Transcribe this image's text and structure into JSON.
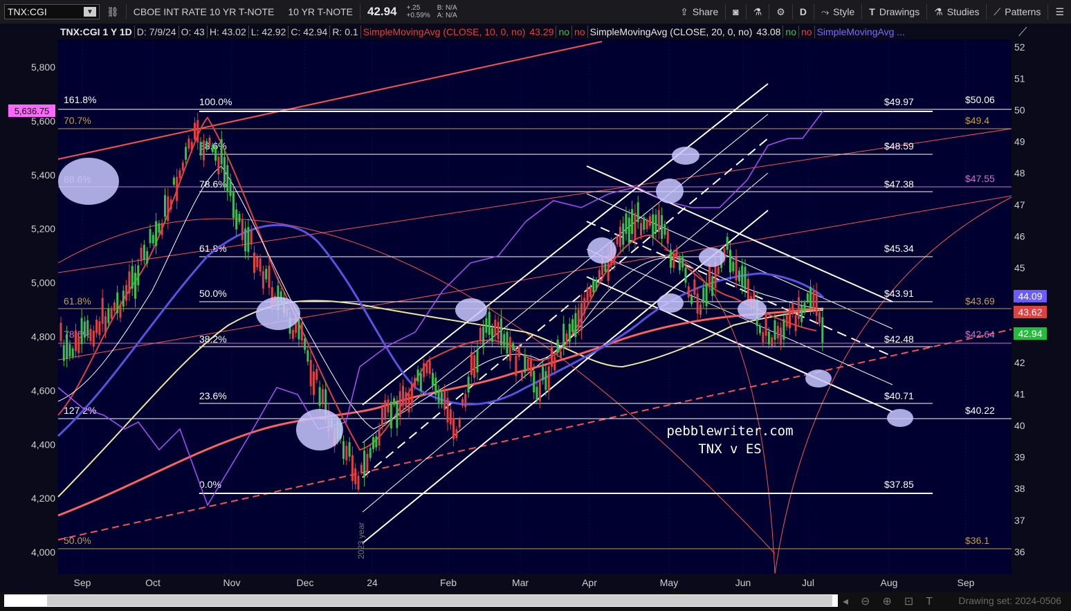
{
  "toolbar": {
    "symbol": "TNX:CGI",
    "description": "CBOE INT RATE 10 YR T-NOTE",
    "short_name": "10 YR T-NOTE",
    "last": "42.94",
    "change": "+.25",
    "change_pct": "+0.59%",
    "bid": "B: N/A",
    "ask": "A: N/A",
    "share": "Share",
    "period": "D",
    "style": "Style",
    "drawings": "Drawings",
    "studies": "Studies",
    "patterns": "Patterns"
  },
  "header": {
    "title": "TNX:CGI 1 Y 1D",
    "date": "D: 7/9/24",
    "open": "O: 43",
    "high": "H: 43.02",
    "low": "L: 42.92",
    "close": "C: 42.94",
    "range": "R: 0.1",
    "sma10": "SimpleMovingAvg (CLOSE, 10, 0, no)",
    "sma10_val": "43.29",
    "sma20": "SimpleMovingAvg (CLOSE, 20, 0, no)",
    "sma20_val": "43.08",
    "sma_next": "SimpleMovingAvg ...",
    "flag_no1": "no",
    "flag_no2": "no"
  },
  "left_axis": {
    "ticks": [
      "5,800",
      "5,600",
      "5,400",
      "5,200",
      "5,000",
      "4,800",
      "4,600",
      "4,400",
      "4,200",
      "4,000"
    ],
    "price_tag": "5,636.75",
    "price_tag_color": "#ff66ff"
  },
  "right_axis": {
    "ticks": [
      "52",
      "51",
      "50",
      "49",
      "48",
      "47",
      "46",
      "45",
      "44",
      "43",
      "42",
      "41",
      "40",
      "39",
      "38",
      "37",
      "36"
    ],
    "tag_blue": "44.09",
    "tag_red": "43.62",
    "tag_green": "42.94"
  },
  "x_axis": {
    "labels": [
      "Sep",
      "Oct",
      "Nov",
      "Dec",
      "24",
      "Feb",
      "Mar",
      "Apr",
      "May",
      "Jun",
      "Jul",
      "Aug",
      "Sep"
    ],
    "year_marker": "2023 year"
  },
  "fib_left": [
    "161.8%",
    "70.7%",
    "88.6%",
    "61.8%",
    "78.6%",
    "127.2%",
    "50.0%"
  ],
  "fib_mid": [
    "100.0%",
    "88.6%",
    "78.6%",
    "61.8%",
    "50.0%",
    "38.2%",
    "23.6%",
    "0.0%"
  ],
  "fib_levels": [
    "$49.97",
    "$48.59",
    "$47.38",
    "$45.34",
    "$43.91",
    "$42.48",
    "$40.71",
    "$37.85"
  ],
  "fib_far": [
    "$50.06",
    "$49.4",
    "$47.55",
    "$43.69",
    "$42.64",
    "$40.22",
    "$36.1"
  ],
  "watermark": {
    "site": "pebblewriter.com",
    "subtitle": "TNX v ES"
  },
  "drawing_set": "Drawing set: 2024-0506",
  "colors": {
    "bg": "#000033",
    "up": "#39c24a",
    "down": "#e04040",
    "sma_red": "#e04040",
    "sma_blue": "#5a52e0",
    "sma_yellow": "#f0e6a0",
    "es": "#b04cff",
    "ellipse": "#c8c8ff"
  }
}
